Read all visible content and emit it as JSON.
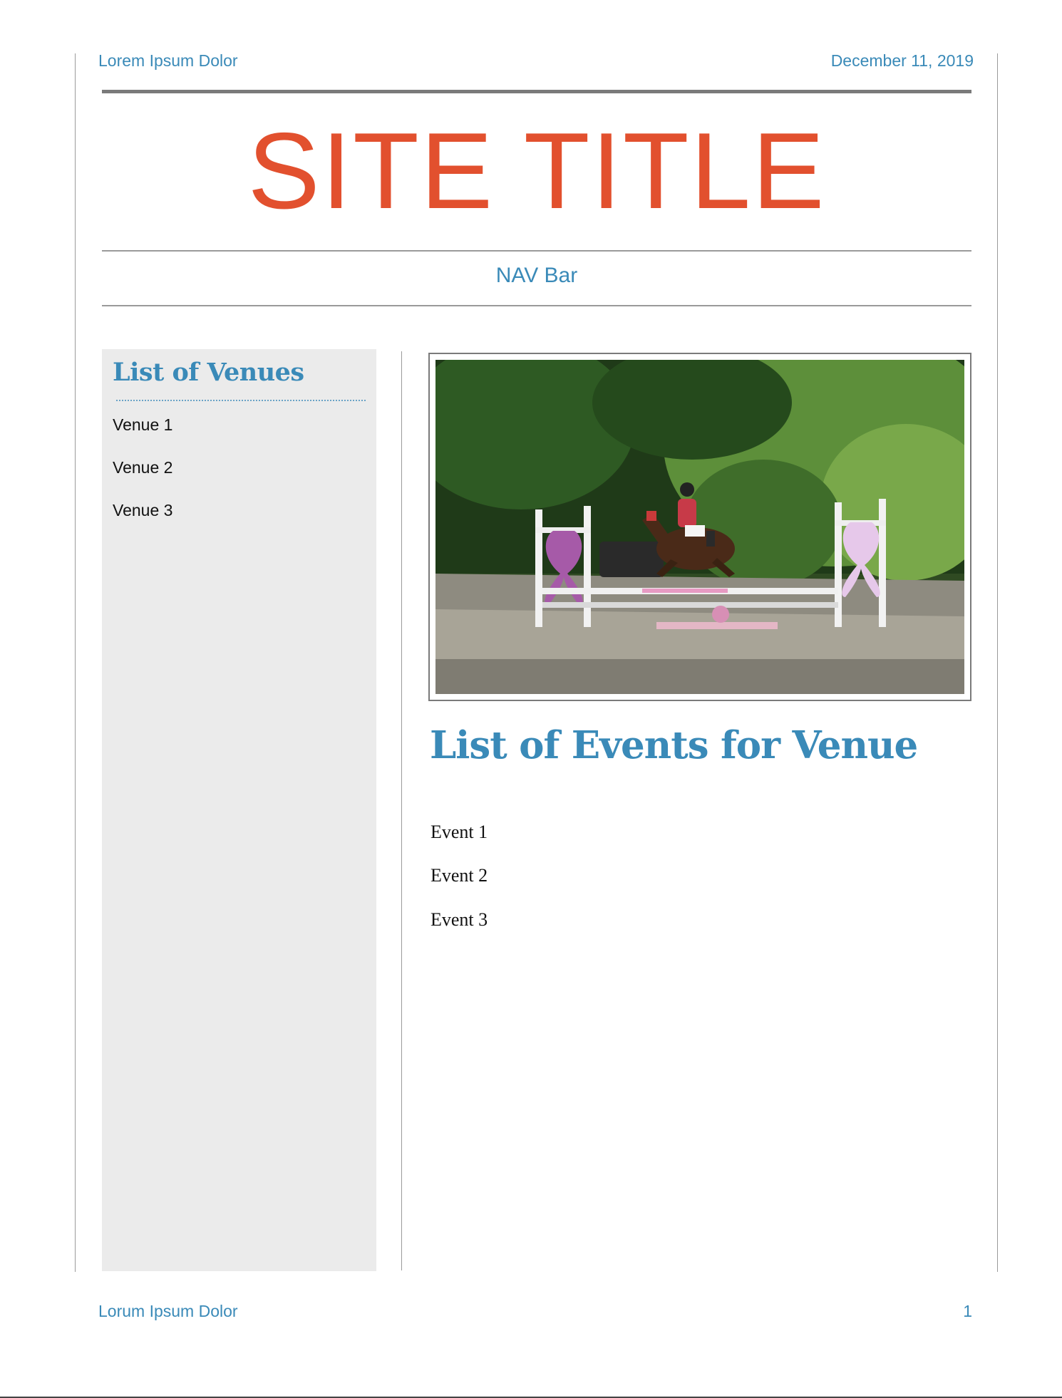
{
  "header": {
    "left_text": "Lorem Ipsum Dolor",
    "date": "December 11, 2019"
  },
  "site_title": "SITE TITLE",
  "nav": {
    "label": "NAV Bar"
  },
  "sidebar": {
    "title": "List of Venues",
    "venues": [
      "Venue 1",
      "Venue 2",
      "Venue 3"
    ]
  },
  "main": {
    "photo_icon": "horse-jumping-photo",
    "events_title": "List of Events for Venue",
    "events": [
      "Event 1",
      "Event 2",
      "Event 3"
    ]
  },
  "footer": {
    "left_text": "Lorum Ipsum Dolor",
    "page_number": "1"
  },
  "colors": {
    "accent": "#3a8ab8",
    "title": "#e2502e",
    "sidebar_bg": "#ebebeb"
  }
}
